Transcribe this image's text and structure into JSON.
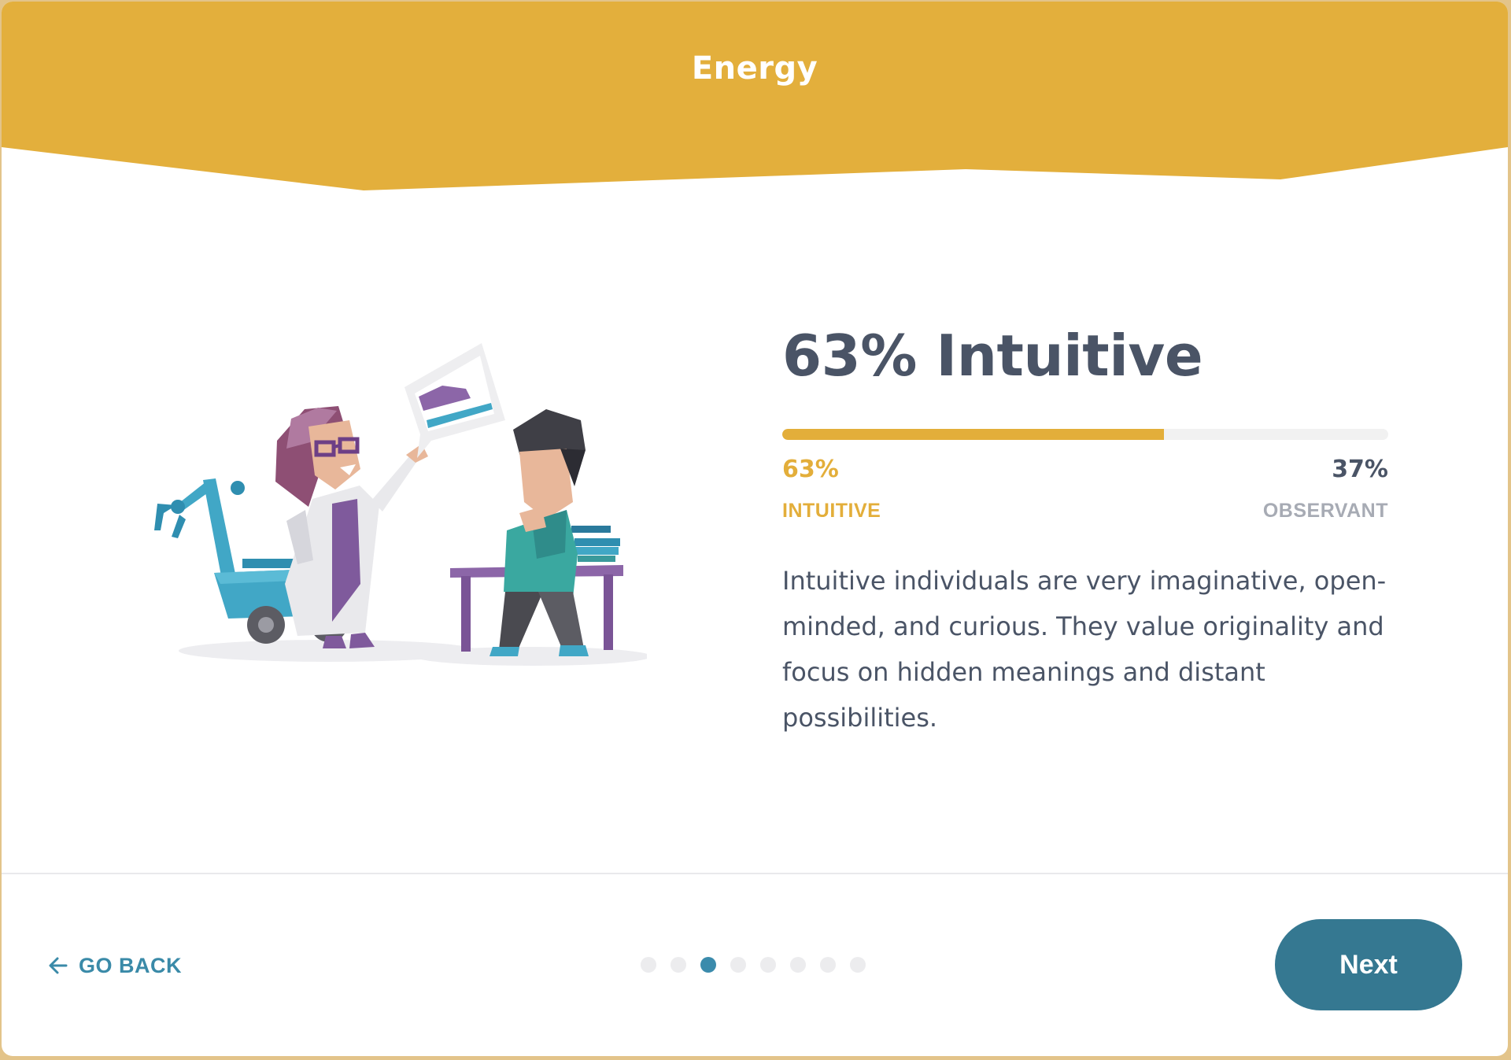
{
  "header": {
    "title": "Energy"
  },
  "result": {
    "title": "63% Intuitive",
    "fill_fraction": 0.63,
    "left_percent": "63%",
    "left_label": "INTUITIVE",
    "right_percent": "37%",
    "right_label": "OBSERVANT",
    "description": "Intuitive individuals are very imaginative, open-minded, and curious. They value originality and focus on hidden meanings and distant possibilities."
  },
  "footer": {
    "back_label": "GO BACK",
    "next_label": "Next",
    "pagination": {
      "total": 8,
      "active_index": 2
    }
  },
  "colors": {
    "header_band": "#e3af3c",
    "accent_gold": "#e3ae3a",
    "teal_button": "#357891",
    "link_blue": "#3a8aa8",
    "text_dark": "#4a5466",
    "text_muted": "#a7abb4"
  },
  "icons": {
    "back": "arrow-left-icon"
  }
}
